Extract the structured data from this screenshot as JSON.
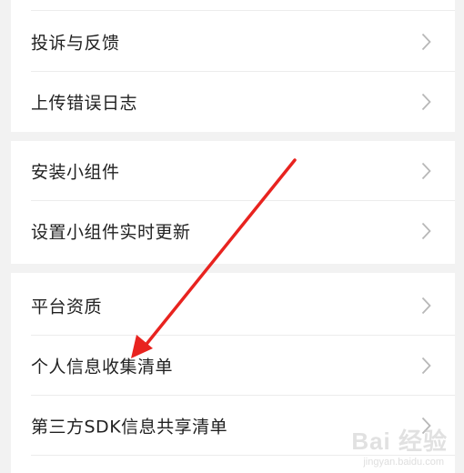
{
  "sections": [
    {
      "items": [
        {
          "label": "投诉与反馈"
        },
        {
          "label": "上传错误日志"
        }
      ]
    },
    {
      "items": [
        {
          "label": "安装小组件"
        },
        {
          "label": "设置小组件实时更新"
        }
      ]
    },
    {
      "items": [
        {
          "label": "平台资质"
        },
        {
          "label": "个人信息收集清单"
        },
        {
          "label": "第三方SDK信息共享清单"
        }
      ]
    }
  ],
  "annotation": {
    "color": "#e8231f"
  },
  "watermark": {
    "text": "Bai 经验",
    "sub": "jingyan.baidu.com"
  }
}
